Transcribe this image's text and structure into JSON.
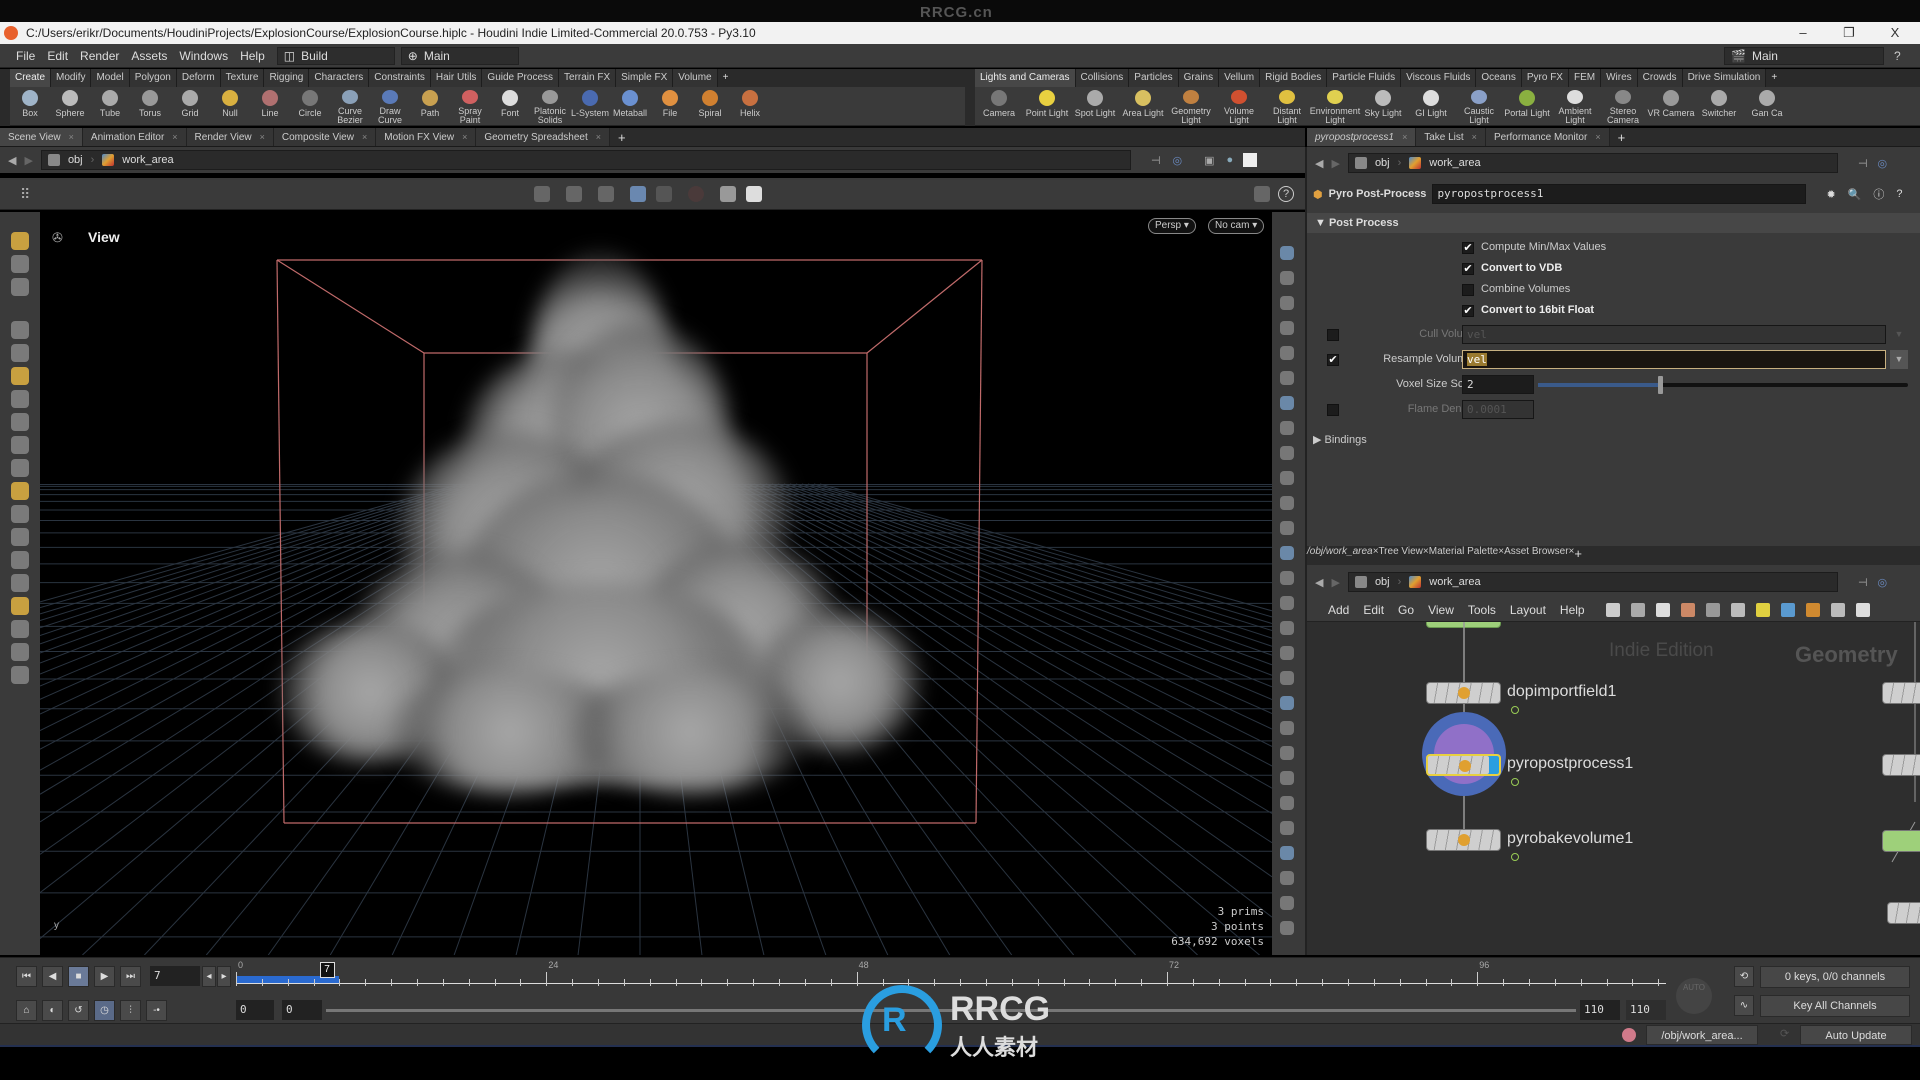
{
  "window": {
    "title": "C:/Users/erikr/Documents/HoudiniProjects/ExplosionCourse/ExplosionCourse.hiplc - Houdini Indie Limited-Commercial 20.0.753 - Py3.10",
    "watermark_top": "RRCG.cn",
    "minimize": "–",
    "restore": "❐",
    "close": "X"
  },
  "menu": {
    "items": [
      "File",
      "Edit",
      "Render",
      "Assets",
      "Windows",
      "Help"
    ],
    "desktop": "Build",
    "desk_main": "Main",
    "right_desk": "Main"
  },
  "shelf_left": {
    "tabs": [
      "Create",
      "Modify",
      "Model",
      "Polygon",
      "Deform",
      "Texture",
      "Rigging",
      "Characters",
      "Constraints",
      "Hair Utils",
      "Guide Process",
      "Terrain FX",
      "Simple FX",
      "Volume"
    ],
    "tools": [
      {
        "label": "Box",
        "color": "#9fb4c8"
      },
      {
        "label": "Sphere",
        "color": "#bbbbbb"
      },
      {
        "label": "Tube",
        "color": "#aaaaaa"
      },
      {
        "label": "Torus",
        "color": "#999999"
      },
      {
        "label": "Grid",
        "color": "#aaaaaa"
      },
      {
        "label": "Null",
        "color": "#d9b040"
      },
      {
        "label": "Line",
        "color": "#b07070"
      },
      {
        "label": "Circle",
        "color": "#777777"
      },
      {
        "label": "Curve Bezier",
        "color": "#8aa0b8"
      },
      {
        "label": "Draw Curve",
        "color": "#5a7ab8"
      },
      {
        "label": "Path",
        "color": "#c8a050"
      },
      {
        "label": "Spray Paint",
        "color": "#d06060"
      },
      {
        "label": "Font",
        "color": "#dddddd"
      },
      {
        "label": "Platonic Solids",
        "color": "#999999"
      },
      {
        "label": "L-System",
        "color": "#4a6ab0"
      },
      {
        "label": "Metaball",
        "color": "#6a90d0"
      },
      {
        "label": "File",
        "color": "#e09040"
      },
      {
        "label": "Spiral",
        "color": "#d08030"
      },
      {
        "label": "Helix",
        "color": "#c87040"
      }
    ]
  },
  "shelf_right": {
    "tabs": [
      "Lights and Cameras",
      "Collisions",
      "Particles",
      "Grains",
      "Vellum",
      "Rigid Bodies",
      "Particle Fluids",
      "Viscous Fluids",
      "Oceans",
      "Pyro FX",
      "FEM",
      "Wires",
      "Crowds",
      "Drive Simulation"
    ],
    "tools": [
      {
        "label": "Camera",
        "color": "#777777"
      },
      {
        "label": "Point Light",
        "color": "#e8d040"
      },
      {
        "label": "Spot Light",
        "color": "#aaaaaa"
      },
      {
        "label": "Area Light",
        "color": "#d8c060"
      },
      {
        "label": "Geometry Light",
        "color": "#c08040"
      },
      {
        "label": "Volume Light",
        "color": "#d05030"
      },
      {
        "label": "Distant Light",
        "color": "#e0c040"
      },
      {
        "label": "Environment Light",
        "color": "#e0d050"
      },
      {
        "label": "Sky Light",
        "color": "#bbbbbb"
      },
      {
        "label": "GI Light",
        "color": "#dddddd"
      },
      {
        "label": "Caustic Light",
        "color": "#8aa0c8"
      },
      {
        "label": "Portal Light",
        "color": "#8ab040"
      },
      {
        "label": "Ambient Light",
        "color": "#dddddd"
      },
      {
        "label": "Stereo Camera",
        "color": "#888888"
      },
      {
        "label": "VR Camera",
        "color": "#999999"
      },
      {
        "label": "Switcher",
        "color": "#aaaaaa"
      },
      {
        "label": "Gan Ca",
        "color": "#aaaaaa"
      }
    ]
  },
  "left_pane": {
    "tabs": [
      "Scene View",
      "Animation Editor",
      "Render View",
      "Composite View",
      "Motion FX View",
      "Geometry Spreadsheet"
    ],
    "path": [
      "obj",
      "work_area"
    ],
    "viewport": {
      "title": "View",
      "persp": "Persp ▾",
      "cam": "No cam ▾",
      "info": [
        "3  prims",
        "3 points",
        "634,692 voxels"
      ],
      "axis": "y"
    }
  },
  "params": {
    "tabs": [
      "pyropostprocess1",
      "Take List",
      "Performance Monitor"
    ],
    "path": [
      "obj",
      "work_area"
    ],
    "node_type": "Pyro Post-Process",
    "node_name": "pyropostprocess1",
    "section": "Post Process",
    "toggles": [
      {
        "label": "Compute Min/Max Values",
        "checked": true
      },
      {
        "label": "Convert to VDB",
        "checked": true
      },
      {
        "label": "Combine Volumes",
        "checked": false
      },
      {
        "label": "Convert to 16bit Float",
        "checked": true
      }
    ],
    "cull_volume": {
      "label": "Cull Volume",
      "value": "vel",
      "enabled": false
    },
    "resample_volumes": {
      "label": "Resample Volumes",
      "value": "vel",
      "enabled": true
    },
    "voxel_size_scale": {
      "label": "Voxel Size Scale",
      "value": "2",
      "slider_fraction": 0.33
    },
    "flame_density": {
      "label": "Flame Density",
      "value": "0.0001",
      "enabled": false
    },
    "bindings": "Bindings",
    "check": "✔"
  },
  "network": {
    "tabs": [
      "/obj/work_area",
      "Tree View",
      "Material Palette",
      "Asset Browser"
    ],
    "path": [
      "obj",
      "work_area"
    ],
    "menu": [
      "Add",
      "Edit",
      "Go",
      "View",
      "Tools",
      "Layout",
      "Help"
    ],
    "watermark": "Indie Edition",
    "context": "Geometry",
    "nodes": [
      {
        "name": "dopimportfield1",
        "selected": false
      },
      {
        "name": "pyropostprocess1",
        "selected": true
      },
      {
        "name": "pyrobakevolume1",
        "selected": false
      }
    ]
  },
  "timeline": {
    "current_frame": "7",
    "ticks": [
      "0",
      "24",
      "48",
      "72",
      "96"
    ],
    "start": "0",
    "start2": "0",
    "end": "110",
    "end2": "110",
    "cached_range": [
      0,
      8
    ],
    "keys_info": "0 keys, 0/0 channels",
    "key_mode": "Key All Channels",
    "auto": "AUTO"
  },
  "status": {
    "path": "/obj/work_area...",
    "update": "Auto Update"
  },
  "brand": {
    "logo_text": "RRCG",
    "logo_sub": "人人素材",
    "accent": "#2a9ee0"
  }
}
